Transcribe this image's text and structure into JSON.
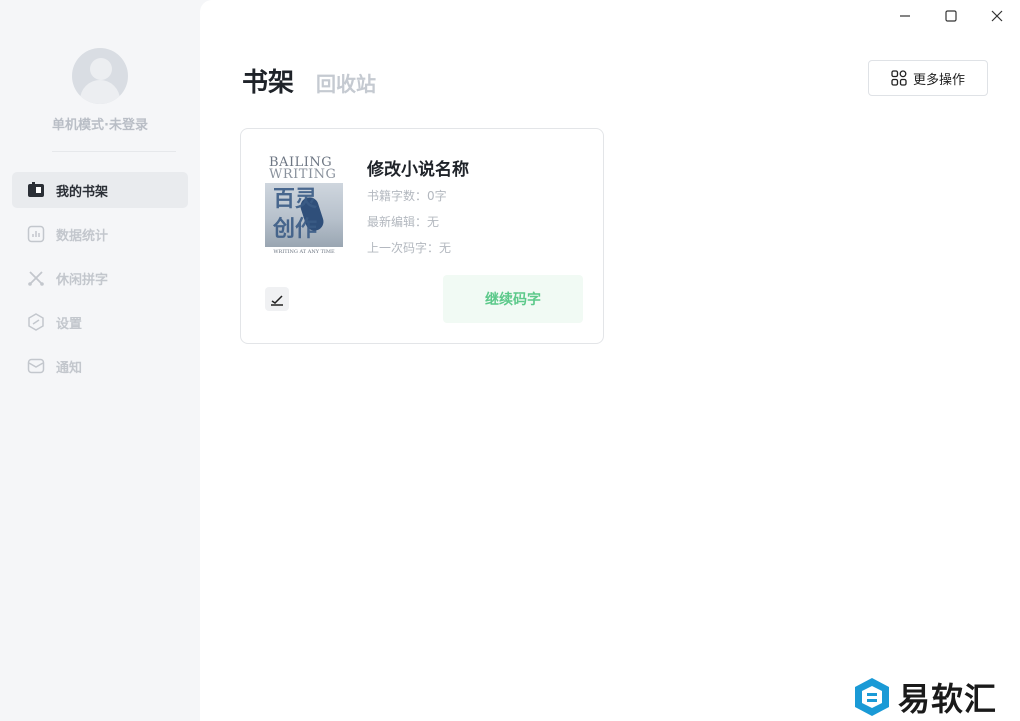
{
  "user": {
    "status_label": "单机模式·未登录"
  },
  "sidebar": {
    "items": [
      {
        "label": "我的书架",
        "icon": "bookshelf-icon",
        "active": true
      },
      {
        "label": "数据统计",
        "icon": "chart-icon",
        "active": false
      },
      {
        "label": "休闲拼字",
        "icon": "game-icon",
        "active": false
      },
      {
        "label": "设置",
        "icon": "settings-icon",
        "active": false
      },
      {
        "label": "通知",
        "icon": "mail-icon",
        "active": false
      }
    ]
  },
  "header": {
    "tab_bookshelf": "书架",
    "tab_recycle": "回收站",
    "more_actions": "更多操作"
  },
  "book": {
    "title": "修改小说名称",
    "word_count": "书籍字数：0字",
    "last_edited": "最新编辑：无",
    "last_typing": "上一次码字：无",
    "continue_label": "继续码字",
    "cover": {
      "en_line1": "BAILING",
      "en_line2": "WRITING",
      "cn_line1": "百灵",
      "cn_line2": "创作",
      "subtitle": "WRITING AT ANY TIME"
    }
  },
  "watermark": {
    "text": "易软汇"
  },
  "colors": {
    "accent_green": "#5cc98a",
    "sidebar_bg": "#f5f6f8",
    "watermark_blue": "#1a9ad6"
  }
}
